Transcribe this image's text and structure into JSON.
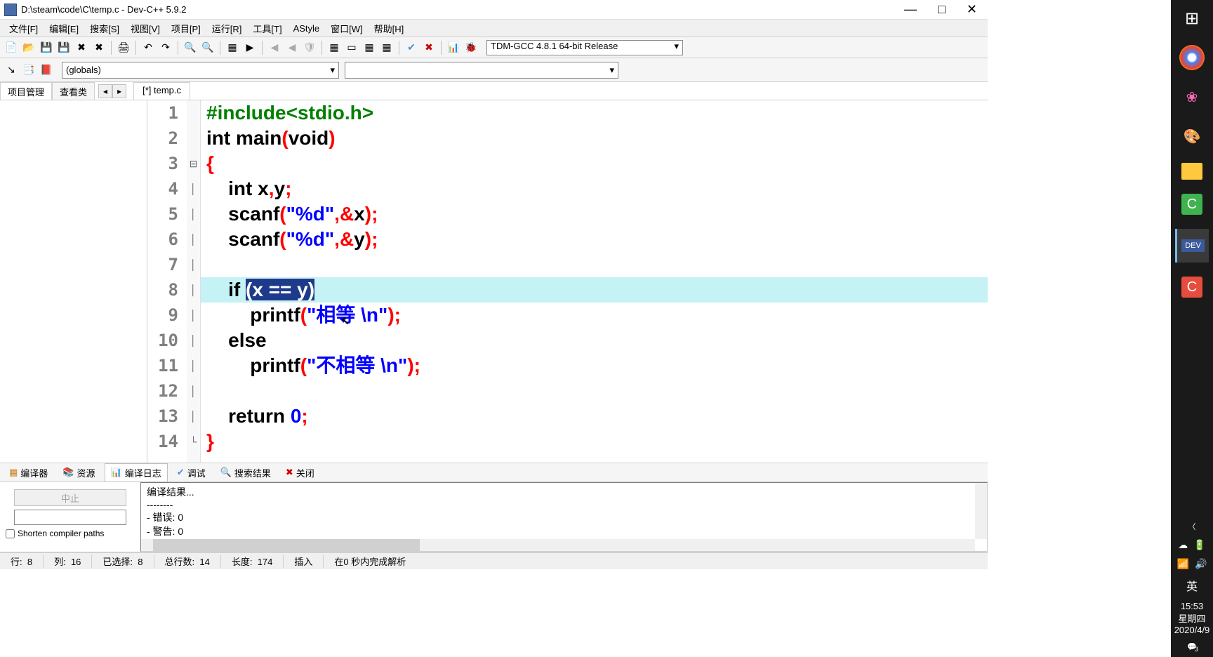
{
  "titlebar": {
    "title": "D:\\steam\\code\\C\\temp.c - Dev-C++ 5.9.2"
  },
  "menu": {
    "items": [
      "文件[F]",
      "编辑[E]",
      "搜索[S]",
      "视图[V]",
      "项目[P]",
      "运行[R]",
      "工具[T]",
      "AStyle",
      "窗口[W]",
      "帮助[H]"
    ]
  },
  "toolbar": {
    "compiler": "TDM-GCC 4.8.1 64-bit Release"
  },
  "toolbar2": {
    "globals": "(globals)"
  },
  "sidetabs": {
    "project": "项目管理",
    "class": "查看类"
  },
  "filetab": "[*] temp.c",
  "gutter": [
    "1",
    "2",
    "3",
    "4",
    "5",
    "6",
    "7",
    "8",
    "9",
    "10",
    "11",
    "12",
    "13",
    "14"
  ],
  "code": {
    "l1_include": "#include<stdio.h>",
    "l2_int": "int",
    "l2_main": " main",
    "l2_paren1": "(",
    "l2_void": "void",
    "l2_paren2": ")",
    "l3": "{",
    "l4_pre": "    ",
    "l4_int": "int",
    "l4_rest": " x",
    "l4_comma": ",",
    "l4_y": "y",
    "l4_semi": ";",
    "l5_pre": "    scanf",
    "l5_p1": "(",
    "l5_str": "\"%d\"",
    "l5_comma": ",",
    "l5_amp": "&",
    "l5_x": "x",
    "l5_p2": ");",
    "l6_pre": "    scanf",
    "l6_p1": "(",
    "l6_str": "\"%d\"",
    "l6_comma": ",",
    "l6_amp": "&",
    "l6_y": "y",
    "l6_p2": ");",
    "l8_pre": "    ",
    "l8_if": "if",
    "l8_space": " ",
    "l8_sel": "(x == y)",
    "l9_pre": "        printf",
    "l9_p1": "(",
    "l9_str": "\"相等 \\n\"",
    "l9_p2": ");",
    "l10_pre": "    ",
    "l10_else": "else",
    "l11_pre": "        printf",
    "l11_p1": "(",
    "l11_str": "\"不相等 \\n\"",
    "l11_p2": ");",
    "l13_pre": "    ",
    "l13_ret": "return",
    "l13_sp": " ",
    "l13_zero": "0",
    "l13_semi": ";",
    "l14": "}"
  },
  "bottomtabs": {
    "compiler": "编译器",
    "resource": "资源",
    "log": "编译日志",
    "debug": "调试",
    "search": "搜索结果",
    "close": "关闭"
  },
  "bottompanel": {
    "stop": "中止",
    "shorten": "Shorten compiler paths",
    "lines": {
      "l1": "编译结果...",
      "l2": "--------",
      "l3": "- 错误: 0",
      "l4": "- 警告: 0"
    }
  },
  "statusbar": {
    "line_label": "行:",
    "line_val": "8",
    "col_label": "列:",
    "col_val": "16",
    "sel_label": "已选择:",
    "sel_val": "8",
    "total_label": "总行数:",
    "total_val": "14",
    "len_label": "长度:",
    "len_val": "174",
    "mode": "插入",
    "parse": "在0 秒内完成解析"
  },
  "wintaskbar": {
    "lang": "英",
    "time": "15:53",
    "day": "星期四",
    "date": "2020/4/9",
    "notif": "3"
  }
}
